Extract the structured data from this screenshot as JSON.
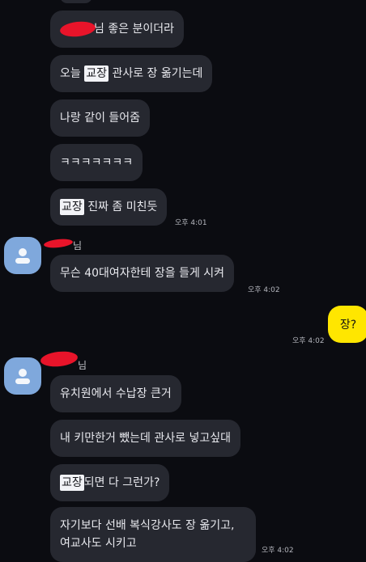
{
  "msgs_a": [
    "님 좋은 분이더라",
    "오늘",
    "교장",
    "관사로 장 옮기는데",
    "나랑 같이 들어줌",
    "ㅋㅋㅋㅋㅋㅋㅋ",
    "진짜 좀 미친듯"
  ],
  "time_a": "오후 4:01",
  "sender_suffix": "님",
  "msg_b1": "무슨 40대여자한테 장을 들게 시켜",
  "time_b": "오후 4:02",
  "mine": {
    "text": "장?",
    "time": "오후 4:02",
    "color": "#ffe600"
  },
  "msgs_c": [
    "유치원에서 수납장 큰거",
    "내 키만한거 뺐는데 관사로 넣고싶대",
    "되면 다 그런가?",
    "자기보다 선배 복식강사도 장 옮기고,",
    "여교사도 시키고"
  ],
  "time_c": "오후 4:02",
  "icons": {
    "avatar": "person-icon"
  }
}
